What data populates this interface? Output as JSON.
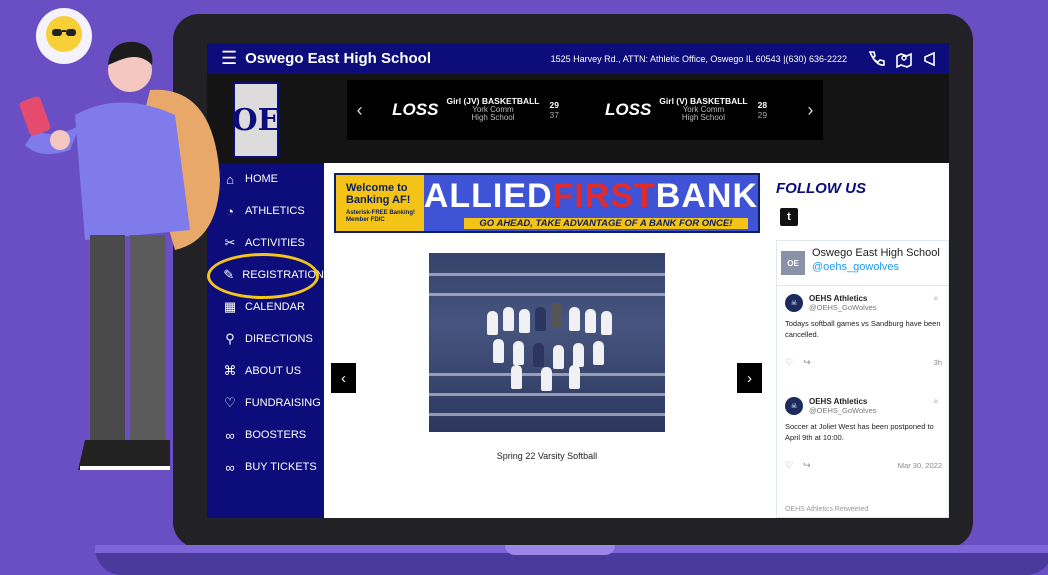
{
  "topbar": {
    "title": "Oswego East High School",
    "contact": "1525 Harvey Rd., ATTN: Athletic Office, Oswego IL 60543 |(630) 636-2222"
  },
  "logo": {
    "text": "OE"
  },
  "scores": [
    {
      "result": "LOSS",
      "title": "Girl (JV) BASKETBALL",
      "opponent_line1": "York Comm",
      "opponent_line2": "High School",
      "our_score": "29",
      "their_score": "37"
    },
    {
      "result": "LOSS",
      "title": "Girl (V) BASKETBALL",
      "opponent_line1": "York Comm",
      "opponent_line2": "High School",
      "our_score": "28",
      "their_score": "29"
    }
  ],
  "nav": [
    {
      "label": "HOME",
      "icon": "home-icon"
    },
    {
      "label": "ATHLETICS",
      "icon": "whistle-icon"
    },
    {
      "label": "ACTIVITIES",
      "icon": "tools-icon"
    },
    {
      "label": "REGISTRATION",
      "icon": "user-edit-icon"
    },
    {
      "label": "CALENDAR",
      "icon": "calendar-icon"
    },
    {
      "label": "DIRECTIONS",
      "icon": "map-icon"
    },
    {
      "label": "ABOUT US",
      "icon": "building-icon"
    },
    {
      "label": "FUNDRAISING",
      "icon": "hand-heart-icon"
    },
    {
      "label": "BOOSTERS",
      "icon": "link-icon"
    },
    {
      "label": "BUY TICKETS",
      "icon": "link-icon"
    }
  ],
  "ad": {
    "left_line1": "Welcome to",
    "left_line2": "Banking AF!",
    "left_small": "Asterisk-FREE Banking!  Member FDIC",
    "brand_part1": "ALLIED",
    "brand_part2": "FIRST",
    "brand_part3": "BANK",
    "tagline": "GO AHEAD, TAKE ADVANTAGE OF A BANK FOR ONCE!"
  },
  "slideshow": {
    "caption": "Spring 22 Varsity Softball"
  },
  "social": {
    "heading": "FOLLOW US",
    "profile_name": "Oswego East High School",
    "profile_handle": "@oehs_gowolves",
    "tweets": [
      {
        "name": "OEHS Athletics",
        "handle": "@OEHS_GoWolves",
        "text": "Todays softball games vs Sandburg have been cancelled.",
        "date": "3h"
      },
      {
        "name": "OEHS Athletics",
        "handle": "@OEHS_GoWolves",
        "text": "Soccer at Joliet West has been postponed to April 9th at 10:00.",
        "date": "Mar 30, 2022"
      }
    ],
    "retweeted": "OEHS Athletics Retweeted"
  },
  "colors": {
    "nav_blue": "#0c0c7a",
    "highlight": "#f5c518",
    "background": "#6a4fc4"
  }
}
